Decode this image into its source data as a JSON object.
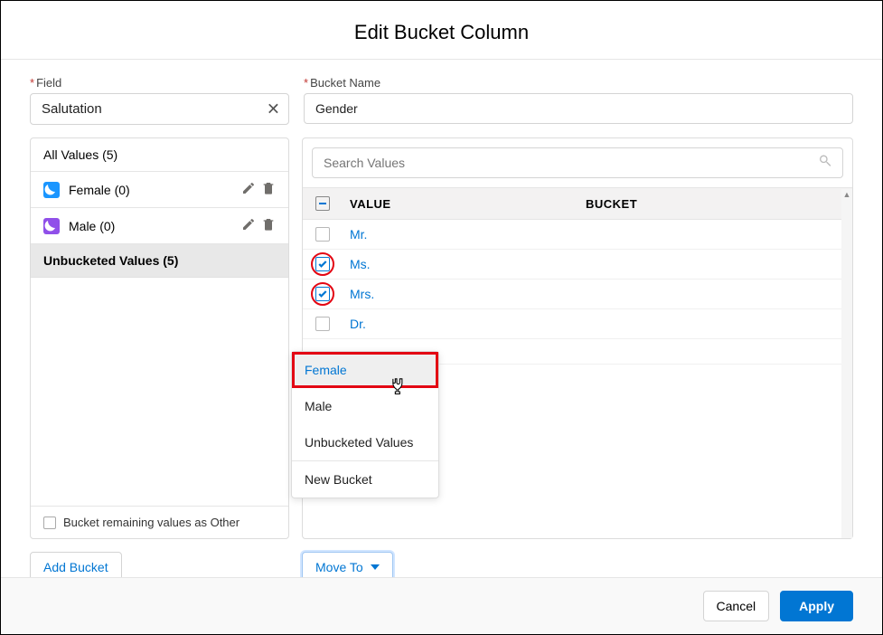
{
  "title": "Edit Bucket Column",
  "field": {
    "label": "Field",
    "value": "Salutation"
  },
  "bucketName": {
    "label": "Bucket Name",
    "value": "Gender"
  },
  "left": {
    "allValues": "All Values (5)",
    "buckets": [
      {
        "label": "Female (0)"
      },
      {
        "label": "Male (0)"
      }
    ],
    "active": "Unbucketed Values (5)",
    "remainingLabel": "Bucket remaining values as Other"
  },
  "search": {
    "placeholder": "Search Values"
  },
  "tableHead": {
    "value": "VALUE",
    "bucket": "BUCKET"
  },
  "values": [
    {
      "label": "Mr.",
      "checked": false,
      "emphasis": false
    },
    {
      "label": "Ms.",
      "checked": true,
      "emphasis": true
    },
    {
      "label": "Mrs.",
      "checked": true,
      "emphasis": true
    },
    {
      "label": "Dr.",
      "checked": false,
      "emphasis": false
    }
  ],
  "dropdown": {
    "items": [
      {
        "label": "Female",
        "hover": true
      },
      {
        "label": "Male",
        "hover": false
      },
      {
        "label": "Unbucketed Values",
        "hover": false
      },
      {
        "label": "New Bucket",
        "hover": false,
        "sep": true
      }
    ]
  },
  "buttons": {
    "addBucket": "Add Bucket",
    "moveTo": "Move To",
    "cancel": "Cancel",
    "apply": "Apply"
  }
}
